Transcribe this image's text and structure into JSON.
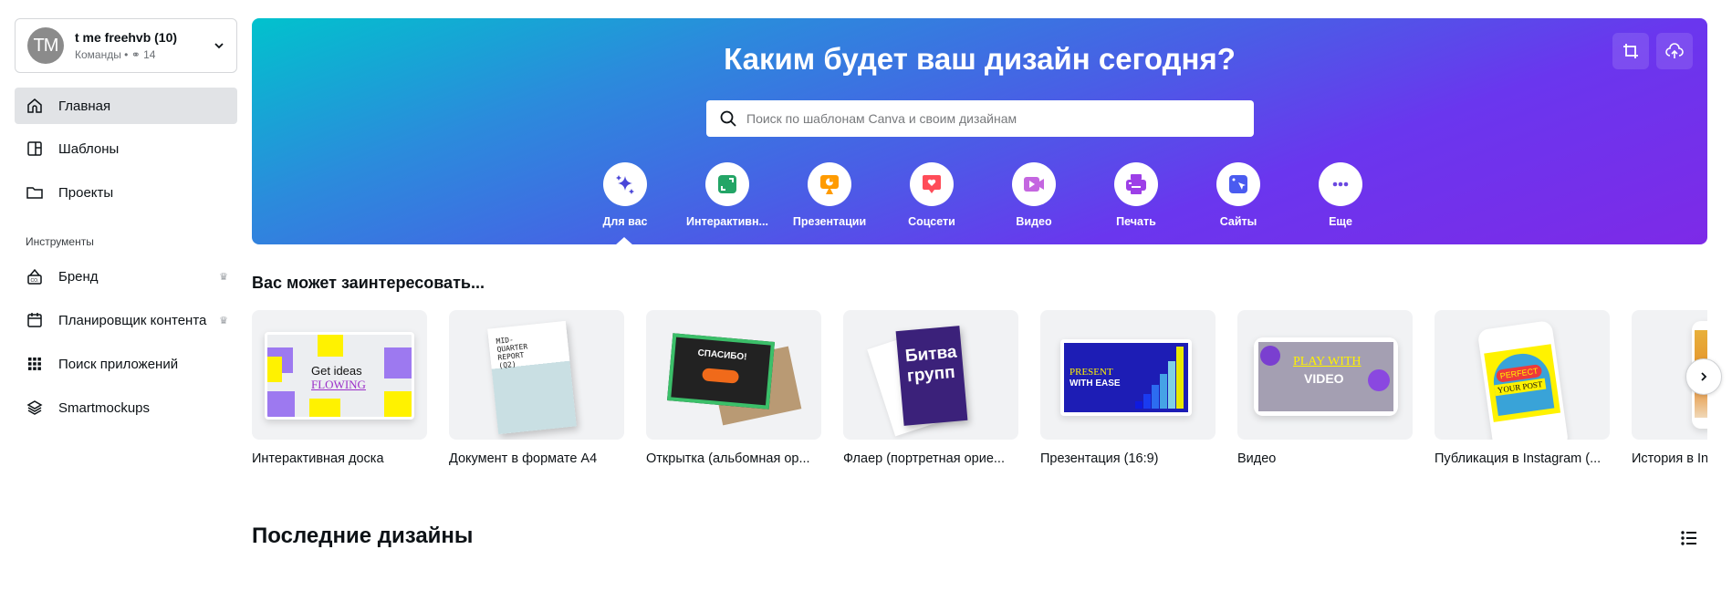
{
  "team": {
    "initials": "TM",
    "name": "t me freehvb (10)",
    "type": "Команды",
    "members": "14"
  },
  "sidebar": {
    "items": [
      {
        "label": "Главная",
        "icon": "home-icon",
        "active": true
      },
      {
        "label": "Шаблоны",
        "icon": "templates-icon"
      },
      {
        "label": "Проекты",
        "icon": "folder-icon"
      }
    ],
    "tools_label": "Инструменты",
    "tools": [
      {
        "label": "Бренд",
        "icon": "brand-icon",
        "premium": true
      },
      {
        "label": "Планировщик контента",
        "icon": "calendar-icon",
        "premium": true
      },
      {
        "label": "Поиск приложений",
        "icon": "apps-grid-icon"
      },
      {
        "label": "Smartmockups",
        "icon": "layers-icon"
      }
    ]
  },
  "banner": {
    "title": "Каким будет ваш дизайн сегодня?",
    "search_placeholder": "Поиск по шаблонам Canva и своим дизайнам",
    "categories": [
      {
        "label": "Для вас",
        "icon": "sparkle-icon",
        "color": "#4a46d8",
        "selected": true
      },
      {
        "label": "Интерактивн...",
        "icon": "whiteboard-icon",
        "color": "#23a566"
      },
      {
        "label": "Презентации",
        "icon": "presentation-icon",
        "color": "#ff9b00"
      },
      {
        "label": "Соцсети",
        "icon": "heart-chat-icon",
        "color": "#ff4c58"
      },
      {
        "label": "Видео",
        "icon": "video-camera-icon",
        "color": "#c466e0"
      },
      {
        "label": "Печать",
        "icon": "printer-icon",
        "color": "#9d3fe7"
      },
      {
        "label": "Сайты",
        "icon": "website-cursor-icon",
        "color": "#4a5bf0"
      },
      {
        "label": "Еще",
        "icon": "more-dots-icon",
        "color": "#6a48e0"
      }
    ]
  },
  "suggestions": {
    "title": "Вас может заинтересовать...",
    "items": [
      {
        "label": "Интерактивная доска",
        "thumb_text": [
          "Get ideas",
          "FLOWING"
        ]
      },
      {
        "label": "Документ в формате А4",
        "thumb_text": [
          "MID-",
          "QUARTER",
          "REPORT",
          "(Q2)"
        ]
      },
      {
        "label": "Открытка (альбомная ор...",
        "thumb_text": [
          "СПАСИБО!"
        ]
      },
      {
        "label": "Флаер (портретная орие...",
        "thumb_text": [
          "Битва",
          "групп"
        ]
      },
      {
        "label": "Презентация (16:9)",
        "thumb_text": [
          "PRESENT",
          "WITH EASE"
        ]
      },
      {
        "label": "Видео",
        "thumb_text": [
          "PLAY WITH",
          "VIDEO"
        ]
      },
      {
        "label": "Публикация в Instagram (...",
        "thumb_text": [
          "PERFECT",
          "YOUR POST"
        ]
      },
      {
        "label": "История в Instagram",
        "thumb_text": []
      }
    ]
  },
  "recent": {
    "title": "Последние дизайны"
  }
}
